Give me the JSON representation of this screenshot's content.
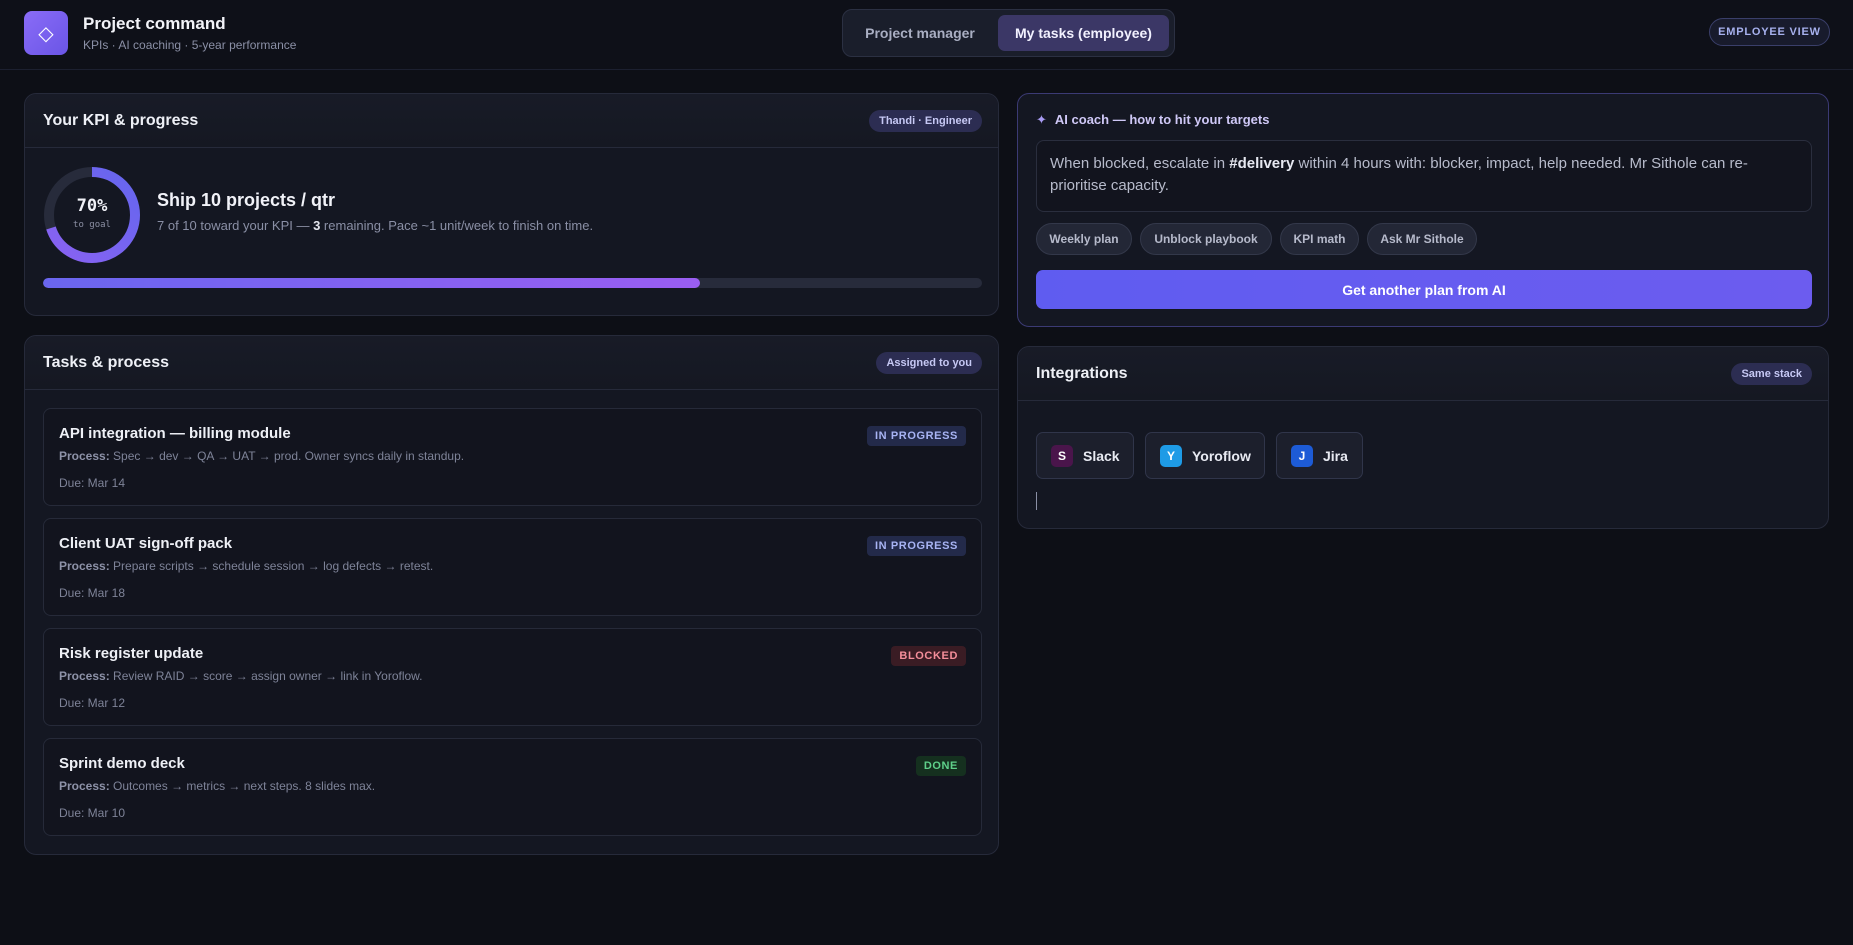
{
  "header": {
    "logo_glyph": "◇",
    "title": "Project command",
    "subtitle": "KPIs · AI coaching · 5-year performance",
    "tabs": [
      {
        "label": "Project manager",
        "active": false
      },
      {
        "label": "My tasks (employee)",
        "active": true
      }
    ],
    "view_badge": "EMPLOYEE VIEW"
  },
  "kpi": {
    "title": "Your KPI & progress",
    "badge": "Thandi · Engineer",
    "progress_percent": 70,
    "ring_label": "70%",
    "ring_sublabel": "to goal",
    "goal_title": "Ship 10 projects / qtr",
    "desc_before": "7 of 10 toward your KPI — ",
    "desc_bold": "3",
    "desc_after": " remaining. Pace ~1 unit/week to finish on time."
  },
  "tasks": {
    "title": "Tasks & process",
    "badge": "Assigned to you",
    "process_label": "Process:",
    "items": [
      {
        "title": "API integration — billing module",
        "process": "Spec → dev → QA → UAT → prod. Owner syncs daily in standup.",
        "due": "Due: Mar 14",
        "status": "IN PROGRESS"
      },
      {
        "title": "Client UAT sign-off pack",
        "process": "Prepare scripts → schedule session → log defects → retest.",
        "due": "Due: Mar 18",
        "status": "IN PROGRESS"
      },
      {
        "title": "Risk register update",
        "process": "Review RAID → score → assign owner → link in Yoroflow.",
        "due": "Due: Mar 12",
        "status": "BLOCKED"
      },
      {
        "title": "Sprint demo deck",
        "process": "Outcomes → metrics → next steps. 8 slides max.",
        "due": "Due: Mar 10",
        "status": "DONE"
      }
    ]
  },
  "coach": {
    "icon": "✦",
    "title": "AI coach — how to hit your targets",
    "msg_before": "When blocked, escalate in ",
    "msg_bold": "#delivery",
    "msg_after": " within 4 hours with: blocker, impact, help needed. Mr Sithole can re-prioritise capacity.",
    "chips": [
      "Weekly plan",
      "Unblock playbook",
      "KPI math",
      "Ask Mr Sithole"
    ],
    "button": "Get another plan from AI"
  },
  "integrations": {
    "title": "Integrations",
    "badge": "Same stack",
    "items": [
      {
        "letter": "S",
        "name": "Slack",
        "color": "#4a154b"
      },
      {
        "letter": "Y",
        "name": "Yoroflow",
        "color": "#1e9be6"
      },
      {
        "letter": "J",
        "name": "Jira",
        "color": "#1d5bd6"
      }
    ]
  }
}
